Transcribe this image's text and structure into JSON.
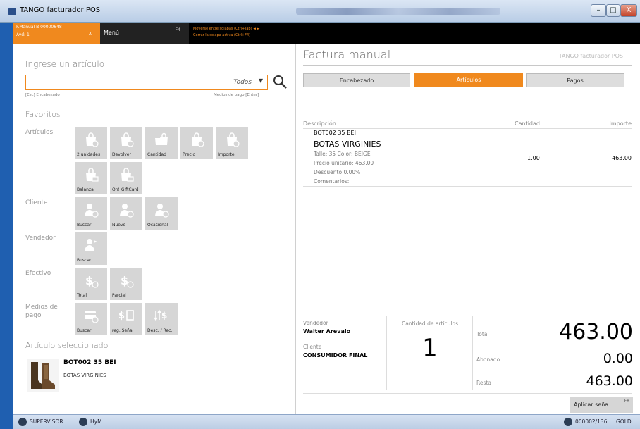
{
  "window": {
    "title": "TANGO facturador POS",
    "min_label": "–",
    "max_label": "□",
    "close_label": "X"
  },
  "menubar": {
    "active_tab_line1": "F.Manual B 00000648",
    "active_tab_line2": "Ayd: 1",
    "active_tab_close": "x",
    "menu_label": "Menú",
    "menu_key": "F4",
    "hint1": "Moverse entre solapas (Ctrl+Tab) ◄ ►",
    "hint2": "Cerrar la solapa activa (Ctrl+F4)"
  },
  "left": {
    "search_title": "Ingrese un artículo",
    "search_placeholder": "Todos",
    "hint_left": "[Esc] Encabezado",
    "hint_right": "Medios de pago [Enter]",
    "favorites_title": "Favoritos",
    "groups": {
      "articulos": "Artículos",
      "cliente": "Cliente",
      "vendedor": "Vendedor",
      "efectivo": "Efectivo",
      "medios": "Medios de pago"
    },
    "tiles": {
      "unidades": "2 unidades",
      "devolver": "Devolver",
      "cantidad": "Cantidad",
      "precio": "Precio",
      "importe": "Importe",
      "balanza": "Balanza",
      "giftcard": "Oh! GiftCard",
      "cli_buscar": "Buscar",
      "cli_nuevo": "Nuevo",
      "cli_ocasional": "Ocasional",
      "ven_buscar": "Buscar",
      "ef_total": "Total",
      "ef_parcial": "Parcial",
      "mp_buscar": "Buscar",
      "mp_sena": "reg. Seña",
      "mp_desc": "Desc. / Rec."
    },
    "selected_title": "Artículo seleccionado",
    "selected_code": "BOT002  35 BEI",
    "selected_name": "BOTAS VIRGINIES"
  },
  "right": {
    "title": "Factura manual",
    "brand": "TANGO facturador POS",
    "tabs": {
      "head": "Encabezado",
      "items": "Artículos",
      "pays": "Pagos"
    },
    "columns": {
      "desc": "Descripción",
      "qty": "Cantidad",
      "amount": "Importe"
    },
    "item": {
      "code": "BOT002  35 BEI",
      "name": "BOTAS VIRGINIES",
      "detail1": "Talle: 35 Color: BEIGE",
      "detail2": "Precio unitario: 463.00",
      "detail3": "Descuento 0.00%",
      "detail4": "Comentarios:",
      "qty": "1.00",
      "amount": "463.00"
    },
    "footer": {
      "vendor_label": "Vendedor",
      "vendor": "Walter Arevalo",
      "client_label": "Cliente",
      "client": "CONSUMIDOR FINAL",
      "count_label": "Cantidad de artículos",
      "count": "1",
      "total_label": "Total",
      "total": "463.00",
      "paid_label": "Abonado",
      "paid": "0.00",
      "rest_label": "Resta",
      "rest": "463.00",
      "apply_label": "Aplicar seña",
      "apply_key": "F8"
    }
  },
  "status": {
    "user": "SUPERVISOR",
    "company": "HyM",
    "doc": "000002/136",
    "level": "GOLD"
  },
  "colors": {
    "accent": "#f0891e",
    "tile": "#d6d6d6",
    "menubar": "#000000"
  }
}
